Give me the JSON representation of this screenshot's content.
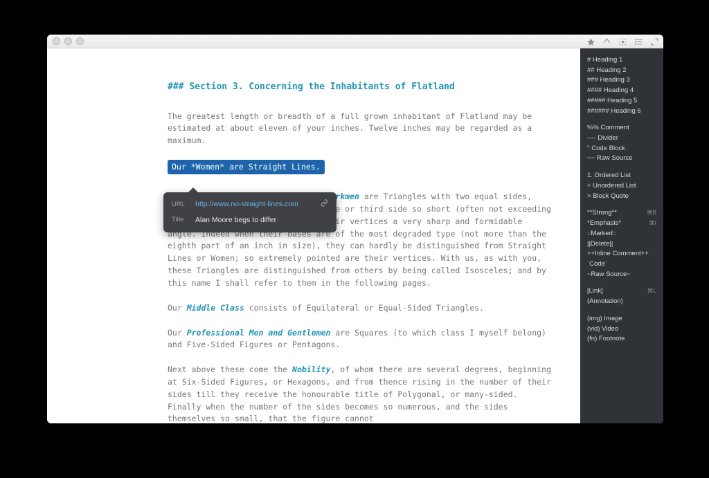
{
  "toolbar": {
    "star_title": "Favorite",
    "share_title": "Share",
    "gear_title": "Settings",
    "list_title": "Outline",
    "expand_title": "Fullscreen"
  },
  "doc": {
    "heading_prefix": "###",
    "heading_text": "Section 3. Concerning the Inhabitants of Flatland",
    "p1": "The greatest length or breadth of a full grown inhabitant of Flatland may be estimated at about eleven of your inches. Twelve inches may be regarded as a maximum.",
    "link_full": "Our *Women* are Straight Lines.",
    "p2_pre": "Our ",
    "p2_em": "Soldiers and Lowest Class of Workmen",
    "p2_post": " are Triangles with two equal sides, about eleven inches long, and a base or third side so short (often not exceeding half an inch) that they form at their vertices a very sharp and formidable angle. Indeed when their bases are of the most degraded type (not more than the eighth part of an inch in size), they can hardly be distinguished from Straight Lines or Women; so extremely pointed are their vertices. With us, as with you, these Triangles are distinguished from others by being called Isosceles; and by this name I shall refer to them in the following pages.",
    "p3_pre": "Our ",
    "p3_em": "Middle Class",
    "p3_post": " consists of Equilateral or Equal-Sided Triangles.",
    "p4_pre": "Our ",
    "p4_em": "Professional Men and Gentlemen",
    "p4_post": " are Squares (to which class I myself belong) and Five-Sided Figures or Pentagons.",
    "p5_pre": "Next above these come the ",
    "p5_em": "Nobility",
    "p5_post": ", of whom there are several degrees, beginning at Six-Sided Figures, or Hexagons, and from thence rising in the number of their sides till they receive the honourable title of Polygonal, or many-sided. Finally when the number of the sides becomes so numerous, and the sides themselves so small, that the figure cannot"
  },
  "popover": {
    "url_label": "URL",
    "url_value": "http://www.no-straight-lines.com",
    "title_label": "Title",
    "title_value": "Alan Moore begs to differ"
  },
  "cheatsheet": {
    "headings": [
      "# Heading 1",
      "## Heading 2",
      "### Heading 3",
      "#### Heading 4",
      "##### Heading 5",
      "###### Heading 6"
    ],
    "block": [
      "%% Comment",
      "---- Divider",
      "'' Code Block",
      "~~ Raw Source"
    ],
    "lists": [
      "1. Ordered List",
      "+ Unordered List",
      "> Block Quote"
    ],
    "inline": [
      {
        "label": "**Strong**",
        "sc": "⌘B"
      },
      {
        "label": "*Emphasis*",
        "sc": "⌘I"
      },
      {
        "label": "::Marked::",
        "sc": ""
      },
      {
        "label": "||Delete||",
        "sc": ""
      },
      {
        "label": "++Inline Comment++",
        "sc": ""
      },
      {
        "label": "`Code`",
        "sc": ""
      },
      {
        "label": "~Raw Source~",
        "sc": ""
      }
    ],
    "links": [
      {
        "label": "[Link]",
        "sc": "⌘L"
      },
      {
        "label": "(Annotation)",
        "sc": ""
      }
    ],
    "media": [
      "(img) Image",
      "(vid) Video",
      "(fn) Footnote"
    ]
  }
}
